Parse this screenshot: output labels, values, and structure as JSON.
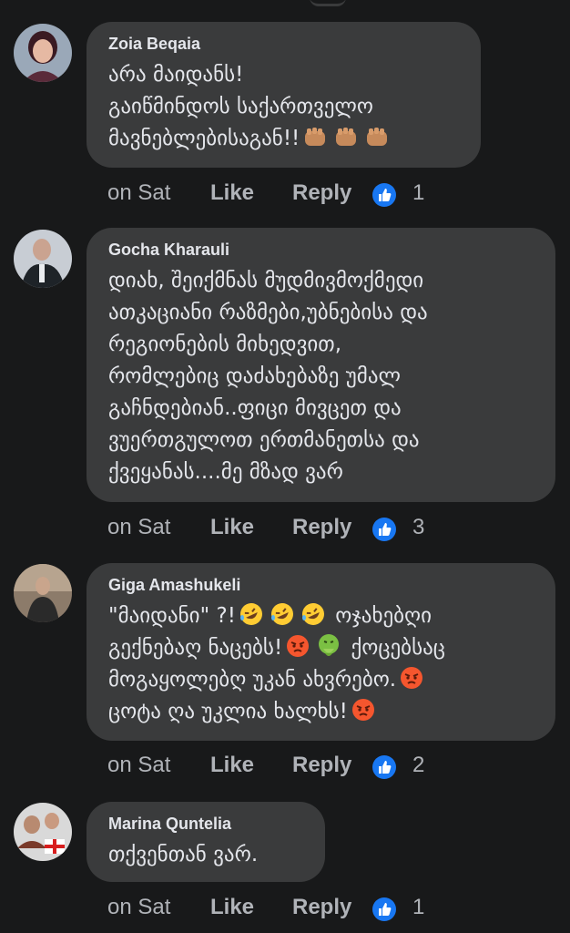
{
  "comments": [
    {
      "author": "Zoia Beqaia",
      "lines": [
        "არა მაიდანს!",
        "გაიწმინდოს საქართველო",
        "მავნებლებისაგან!!"
      ],
      "time": "on Sat",
      "like_label": "Like",
      "reply_label": "Reply",
      "reaction_count": "1"
    },
    {
      "author": "Gocha Kharauli",
      "lines": [
        "დიახ, შეიქმნას მუდმივმოქმედი",
        "ათკაციანი რაზმები,უბნებისა და",
        "რეგიონების მიხედვით,",
        "რომლებიც დაძახებაზე უმალ",
        "გაჩნდებიან..ფიცი მივცეთ და",
        "ვუერთგულოთ ერთმანეთსა და",
        "ქვეყანას....მე მზად ვარ"
      ],
      "time": "on Sat",
      "like_label": "Like",
      "reply_label": "Reply",
      "reaction_count": "3"
    },
    {
      "author": "Giga Amashukeli",
      "lines": [
        "\"მაიდანი\" ?!",
        "გექნებაღ ნაცებს!",
        "მოგაყოლებღ უკან ახვრებო.",
        "ცოტა ღა უკლია  ხალხს!"
      ],
      "time": "on Sat",
      "like_label": "Like",
      "reply_label": "Reply",
      "reaction_count": "2"
    },
    {
      "author": "Marina Quntelia",
      "lines": [
        "თქვენთან ვარ."
      ],
      "time": "on Sat",
      "like_label": "Like",
      "reply_label": "Reply",
      "reaction_count": "1"
    }
  ],
  "giga_extra": {
    "line1_tail": "ოჯახებღი",
    "line3_tail": "ქოცებსაც"
  },
  "colors": {
    "background": "#18191a",
    "bubble": "#3a3b3c",
    "text": "#e4e6eb",
    "secondary": "#b0b3b8",
    "like_blue": "#1877f2"
  }
}
